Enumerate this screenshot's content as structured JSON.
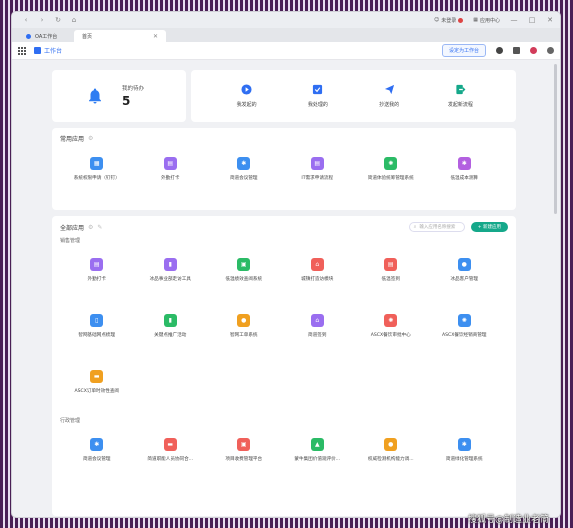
{
  "browser": {
    "nav": [
      "‹",
      "›",
      "↻",
      "⌂"
    ],
    "top_right": [
      {
        "label": "未登录",
        "badge": true
      },
      {
        "label": "应用中心",
        "badge": false
      }
    ],
    "window_controls": [
      "—",
      "□",
      "✕"
    ],
    "tabs": [
      {
        "label": "OA工作台",
        "active": false
      },
      {
        "label": "首页",
        "active": true
      }
    ]
  },
  "toolbar": {
    "brand": "工作台",
    "default_button": "设定为工作台"
  },
  "todo": {
    "label": "我的待办",
    "count": "5"
  },
  "quick_actions": [
    {
      "label": "我发起的",
      "icon": "play-icon",
      "color": "#2f6ef2"
    },
    {
      "label": "我处理的",
      "icon": "check-box-icon",
      "color": "#2f6ef2"
    },
    {
      "label": "抄送我的",
      "icon": "paper-plane-icon",
      "color": "#2f6ef2"
    },
    {
      "label": "发起新流程",
      "icon": "exit-arrow-icon",
      "color": "#15a88a"
    }
  ],
  "common_apps": {
    "title": "常用应用",
    "items": [
      {
        "label": "系统权限申请（钉钉）",
        "color": "#3d8ff0",
        "icon": "grid-icon"
      },
      {
        "label": "外勤打卡",
        "color": "#9a6ef0",
        "icon": "clipboard-icon"
      },
      {
        "label": "简道会议管理",
        "color": "#3d8ff0",
        "icon": "puzzle-icon"
      },
      {
        "label": "IT需求申请流程",
        "color": "#9a6ef0",
        "icon": "clipboard-icon"
      },
      {
        "label": "简道体验统筹管理系统",
        "color": "#2bbb66",
        "icon": "gear-icon"
      },
      {
        "label": "低温成本测算",
        "color": "#b360e0",
        "icon": "puzzle-icon"
      }
    ]
  },
  "all_apps": {
    "title": "全部应用",
    "search_placeholder": "输入应用名称搜索",
    "new_button": "+ 新建应用",
    "categories": [
      {
        "name": "销售管理",
        "items": [
          {
            "label": "外勤打卡",
            "color": "#9a6ef0",
            "icon": "clipboard-icon"
          },
          {
            "label": "冰品事业部走访工具",
            "color": "#9a6ef0",
            "icon": "bar-chart-icon"
          },
          {
            "label": "低温绩效查阅系统",
            "color": "#2bbb66",
            "icon": "gift-icon"
          },
          {
            "label": "城镇打造访模块",
            "color": "#f0605a",
            "icon": "store-icon"
          },
          {
            "label": "低温签到",
            "color": "#f0605a",
            "icon": "clipboard-icon"
          },
          {
            "label": "冰品客户管理",
            "color": "#3d8ff0",
            "icon": "chat-icon"
          },
          {
            "label": "智网基础网点梳理",
            "color": "#3d8ff0",
            "icon": "document-icon"
          },
          {
            "label": "关键点推广活动",
            "color": "#2bbb66",
            "icon": "bar-chart-icon"
          },
          {
            "label": "智网工单系统",
            "color": "#f0a020",
            "icon": "chat-icon"
          },
          {
            "label": "简道签到",
            "color": "#9a6ef0",
            "icon": "store-icon"
          },
          {
            "label": "ASCX餐饮审批中心",
            "color": "#f0605a",
            "icon": "gear-icon"
          },
          {
            "label": "ASCX餐饮经销商管理",
            "color": "#3d8ff0",
            "icon": "gear-icon"
          },
          {
            "label": "ASCX订单时效性查阅",
            "color": "#f0a020",
            "icon": "cart-icon"
          }
        ]
      },
      {
        "name": "行政管理",
        "items": [
          {
            "label": "简道会议管理",
            "color": "#3d8ff0",
            "icon": "puzzle-icon"
          },
          {
            "label": "简道职能人员协同合...",
            "color": "#f0605a",
            "icon": "cart-icon"
          },
          {
            "label": "项目收费管理平台",
            "color": "#f0605a",
            "icon": "gift-icon"
          },
          {
            "label": "蒙牛集团价值观评价...",
            "color": "#2bbb66",
            "icon": "grad-cap-icon"
          },
          {
            "label": "权威检测机构能力调...",
            "color": "#f0a020",
            "icon": "chat-icon"
          },
          {
            "label": "简道绿化管理系统",
            "color": "#3d8ff0",
            "icon": "puzzle-icon"
          }
        ]
      }
    ]
  },
  "watermark": "搜狐号@制造业老简"
}
